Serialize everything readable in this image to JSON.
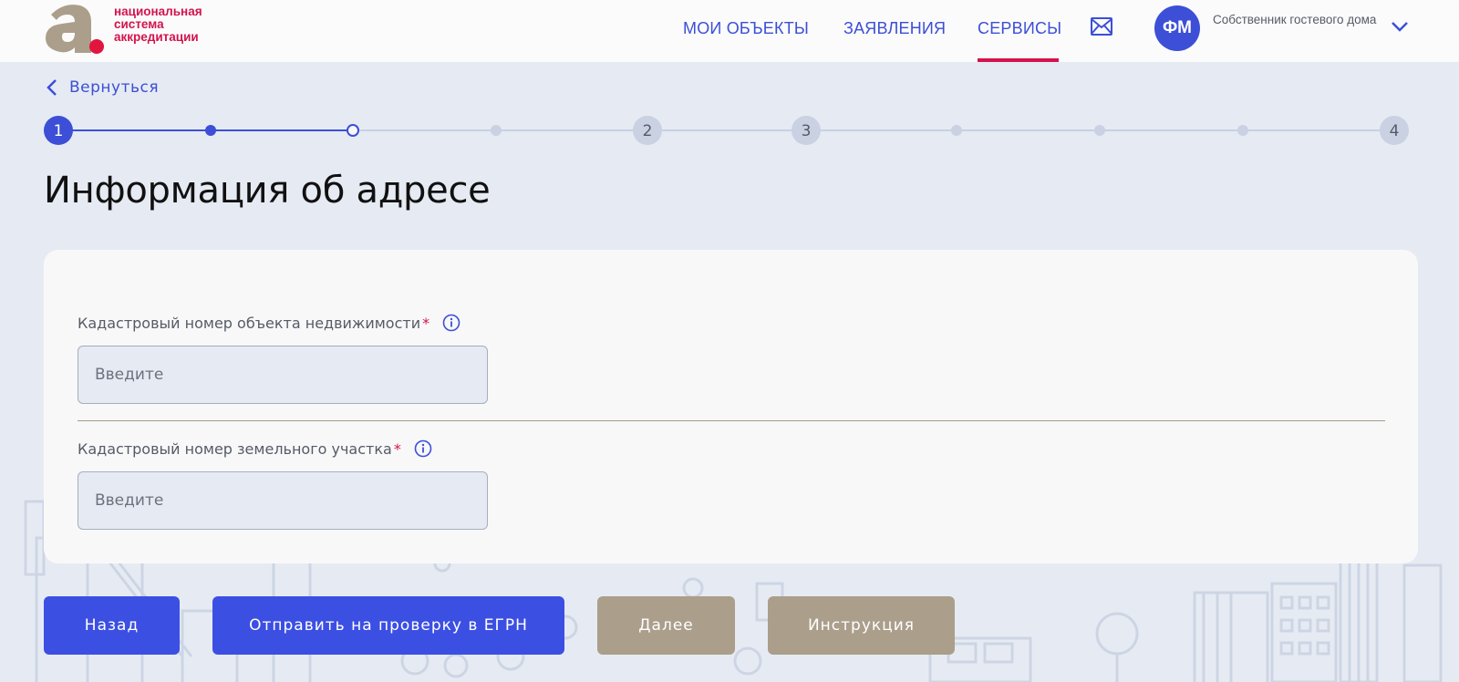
{
  "header": {
    "logo_lines": [
      "национальная",
      "система",
      "аккредитации"
    ],
    "nav": {
      "objects": "МОИ ОБЪЕКТЫ",
      "applications": "ЗАЯВЛЕНИЯ",
      "services": "СЕРВИСЫ",
      "active": "services"
    },
    "user": {
      "initials": "ФМ",
      "role": "Собственник гостевого дома"
    },
    "icons": {
      "logo": "logo-a-icon",
      "mail": "mail-icon",
      "dropdown": "chevron-down-icon"
    }
  },
  "back_link": "Вернуться",
  "stepper": {
    "major_steps": [
      "1",
      "2",
      "3",
      "4"
    ],
    "current_step": 1,
    "sub_progress": "2 of 3 substeps of step 1 complete"
  },
  "page_title": "Информация об адресе",
  "form": {
    "fields": [
      {
        "label": "Кадастровый номер объекта недвижимости",
        "required": "*",
        "placeholder": "Введите",
        "value": ""
      },
      {
        "label": "Кадастровый номер земельного участка",
        "required": "*",
        "placeholder": "Введите",
        "value": ""
      }
    ]
  },
  "buttons": {
    "back": "Назад",
    "send_egrn": "Отправить на проверку в ЕГРН",
    "next": "Далее",
    "instruction": "Инструкция"
  },
  "colors": {
    "primary": "#3c4fe3",
    "accent": "#d3134d",
    "secondary": "#ab9e8b",
    "page_bg": "#e6ebf3"
  }
}
